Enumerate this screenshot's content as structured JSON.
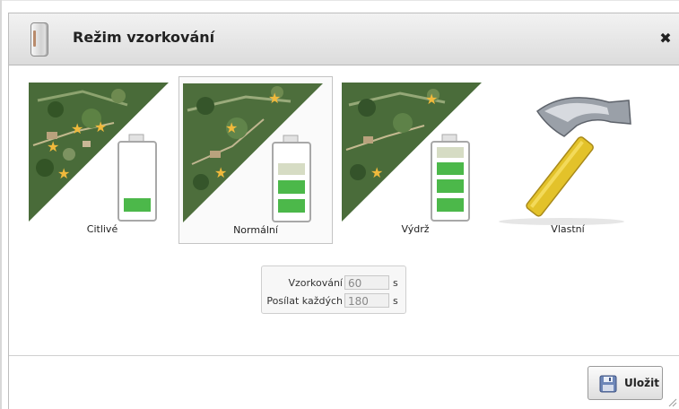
{
  "dialog": {
    "title": "Režim vzorkování",
    "close_label": "✖"
  },
  "modes": [
    {
      "label": "Citlivé",
      "selected": false,
      "battery_level": 1
    },
    {
      "label": "Normální",
      "selected": true,
      "battery_level": 2
    },
    {
      "label": "Výdrž",
      "selected": false,
      "battery_level": 3
    },
    {
      "label": "Vlastní",
      "selected": false
    }
  ],
  "settings": {
    "sampling_label": "Vzorkování",
    "sampling_value": "60",
    "sampling_unit": "s",
    "send_label": "Posílat každých",
    "send_value": "180",
    "send_unit": "s"
  },
  "footer": {
    "save_label": "Uložit"
  },
  "colors": {
    "accent_green": "#3fae3f",
    "hammer_handle": "#e3c22a"
  }
}
